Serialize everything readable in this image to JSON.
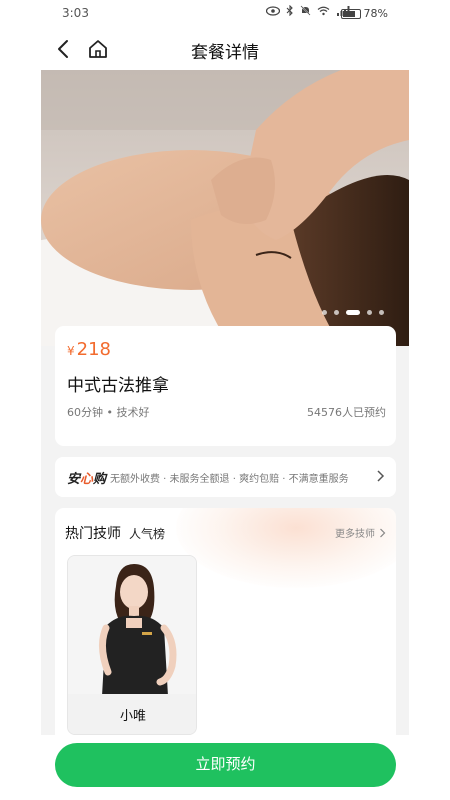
{
  "status_bar": {
    "time": "3:03",
    "battery": "78%",
    "battery_level": 0.78
  },
  "nav": {
    "title": "套餐详情"
  },
  "banner": {
    "slide_count": 5,
    "active_slide": 3
  },
  "package": {
    "currency": "¥",
    "price": "218",
    "name": "中式古法推拿",
    "meta": "60分钟 • 技术好",
    "bookings": "54576人已预约"
  },
  "guarantee": {
    "logo_left": "安",
    "logo_mid": "心",
    "logo_right": "购",
    "text": "无额外收费 · 未服务全额退 · 爽约包赔 · 不满意重服务"
  },
  "technicians": {
    "title": "热门技师",
    "subtitle": "人气榜",
    "more_label": "更多技师",
    "items": [
      {
        "name": "小唯"
      }
    ]
  },
  "cta": {
    "label": "立即预约"
  },
  "colors": {
    "accent": "#1fc15f",
    "price": "#f26b2e"
  }
}
